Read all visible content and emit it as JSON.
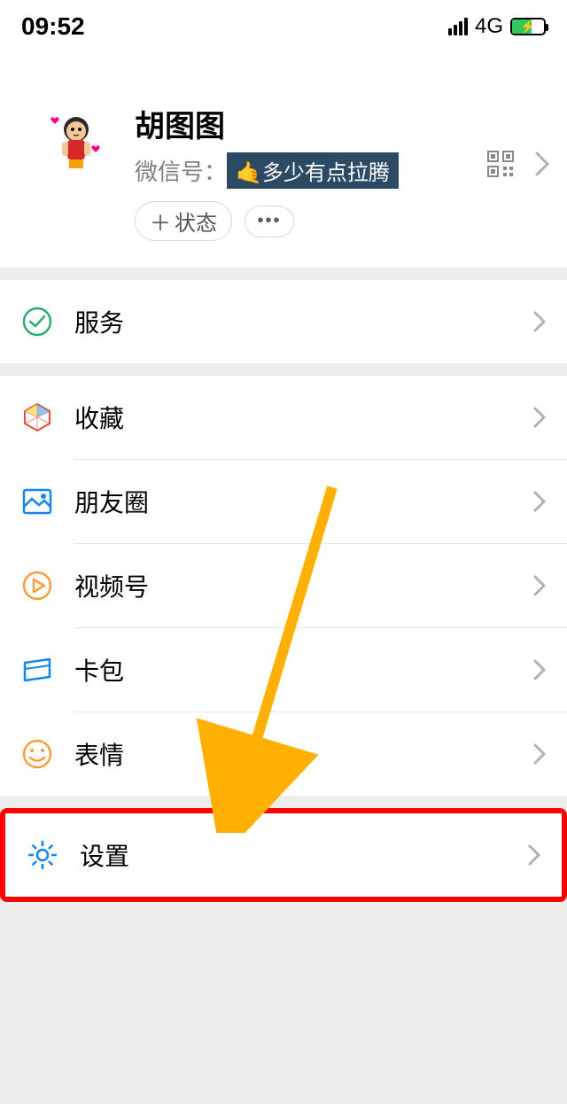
{
  "status_bar": {
    "time": "09:52",
    "network": "4G"
  },
  "profile": {
    "name": "胡图图",
    "id_prefix": "微信号：",
    "id_tag": "🤙多少有点拉腾",
    "status_button": "状态"
  },
  "menu": {
    "services": "服务",
    "favorites": "收藏",
    "moments": "朋友圈",
    "channels": "视频号",
    "cards": "卡包",
    "stickers": "表情",
    "settings": "设置"
  }
}
